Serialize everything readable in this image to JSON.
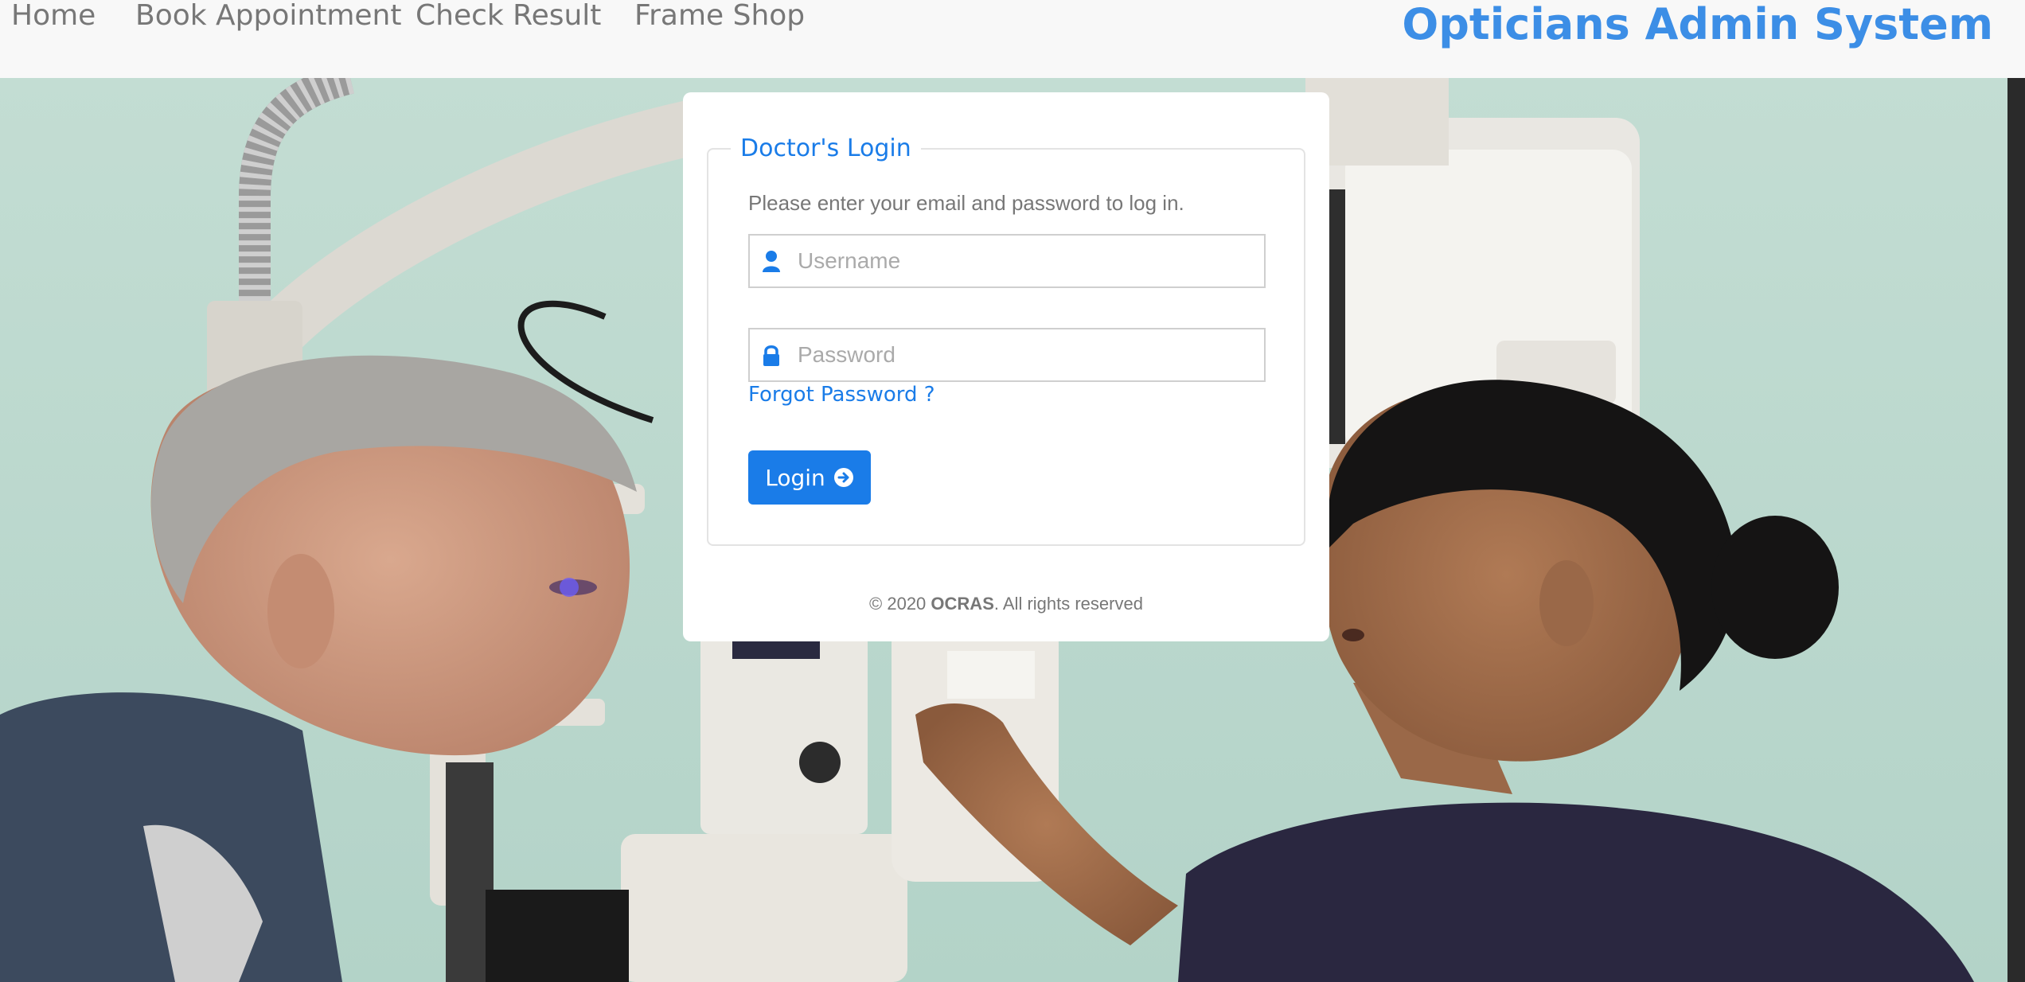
{
  "nav": {
    "links": [
      "Home",
      "Book Appointment",
      "Check Result",
      "Frame Shop"
    ],
    "brand": "Opticians Admin System"
  },
  "login": {
    "legend": "Doctor's Login",
    "hint": "Please enter your email and password to log in.",
    "username_placeholder": "Username",
    "password_placeholder": "Password",
    "forgot_label": "Forgot Password ?",
    "login_label": "Login",
    "icons": {
      "username": "user-icon",
      "password": "lock-icon",
      "login": "arrow-circle-right-icon"
    }
  },
  "footer": {
    "prefix": "© 2020 ",
    "org": "OCRAS",
    "suffix": ". All rights reserved"
  },
  "colors": {
    "accent": "#1a7ce8",
    "brand": "#3c8ee6",
    "nav_bg": "#f8f8f8",
    "hero_wall": "#bcd9cf"
  }
}
